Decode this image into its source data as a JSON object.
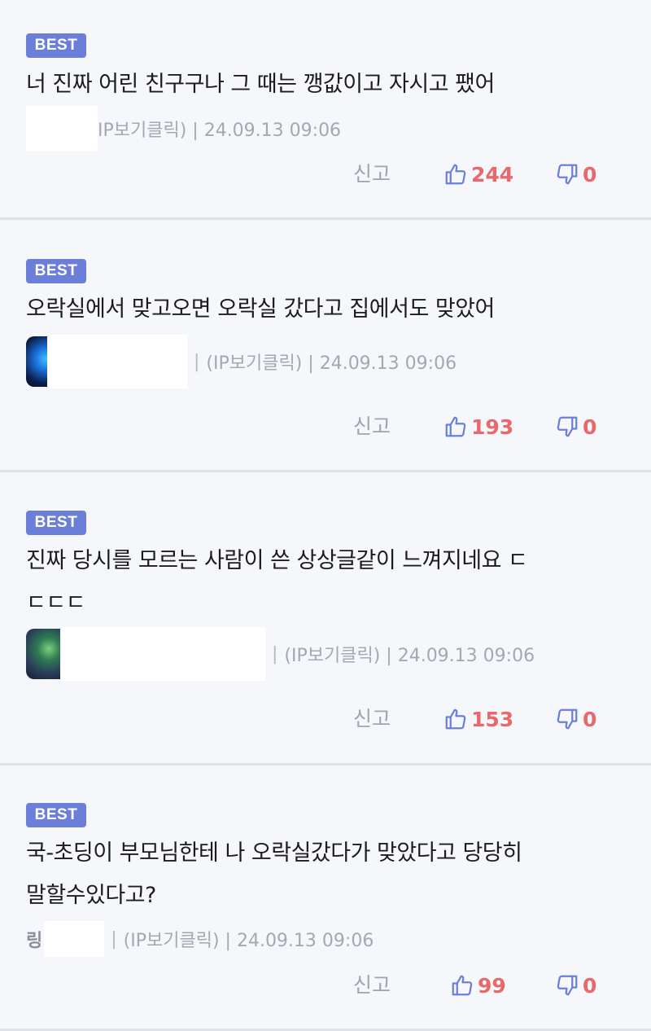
{
  "comments": [
    {
      "badge": "BEST",
      "lines": [
        "너 진짜 어린 친구구나 그 때는 깽값이고 자시고 팼어"
      ],
      "nick_visible": "",
      "meta_tail": "IP보기클릭) | 24.09.13 09:06",
      "report": "신고",
      "likes": "244",
      "dislikes": "0"
    },
    {
      "badge": "BEST",
      "lines": [
        "오락실에서 맞고오면 오락실 갔다고 집에서도 맞았어"
      ],
      "nick_visible": "",
      "meta_tail": "(IP보기클릭) | 24.09.13 09:06",
      "report": "신고",
      "likes": "193",
      "dislikes": "0"
    },
    {
      "badge": "BEST",
      "lines": [
        "진짜 당시를 모르는 사람이 쓴 상상글같이 느껴지네요 ㄷ",
        "ㄷㄷㄷ"
      ],
      "nick_visible": "",
      "meta_tail": "(IP보기클릭) | 24.09.13 09:06",
      "report": "신고",
      "likes": "153",
      "dislikes": "0"
    },
    {
      "badge": "BEST",
      "lines": [
        "국-초딩이 부모님한테 나 오락실갔다가 맞았다고 당당히",
        "말할수있다고?"
      ],
      "nick_visible": "링",
      "meta_tail": "(IP보기클릭) | 24.09.13 09:06",
      "report": "신고",
      "likes": "99",
      "dislikes": "0"
    }
  ],
  "colors": {
    "badge": "#6c7fd8",
    "count": "#e8686c",
    "icon": "#6c7fd8",
    "meta": "#a4a8b0"
  },
  "icons": {
    "like": "thumbs-up-icon",
    "dislike": "thumbs-down-icon"
  }
}
